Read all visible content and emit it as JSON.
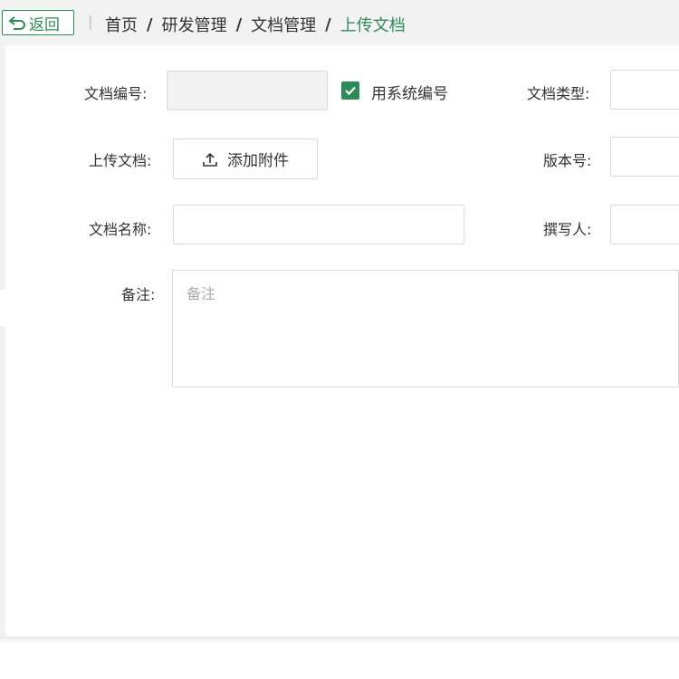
{
  "header": {
    "back_label": "返回",
    "separator": "|",
    "breadcrumb": [
      "首页",
      "研发管理",
      "文档管理",
      "上传文档"
    ],
    "breadcrumb_separator": "/"
  },
  "form": {
    "doc_number_label": "文档编号:",
    "doc_number_value": "",
    "use_system_number_label": "用系统编号",
    "use_system_number_checked": true,
    "doc_type_label": "文档类型:",
    "upload_label": "上传文档:",
    "add_attachment_label": "添加附件",
    "version_label": "版本号:",
    "doc_name_label": "文档名称:",
    "author_label": "撰写人:",
    "remark_label": "备注:",
    "remark_placeholder": "备注"
  },
  "colors": {
    "accent": "#2e8b57",
    "border": "#d9d9d9",
    "topbar_bg": "#f2f2f2"
  }
}
